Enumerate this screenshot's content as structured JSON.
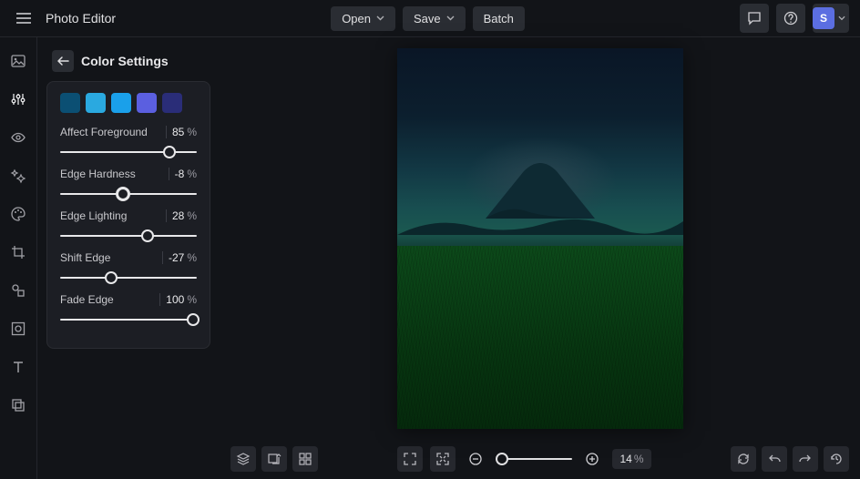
{
  "app_title": "Photo Editor",
  "top": {
    "open": "Open",
    "save": "Save",
    "batch": "Batch",
    "avatar_letter": "S"
  },
  "rail_icons": [
    "image-icon",
    "adjust-icon",
    "eye-icon",
    "effects-icon",
    "palette-icon",
    "crop-icon",
    "shapes-icon",
    "pattern-icon",
    "text-icon",
    "layers-copy-icon"
  ],
  "panel": {
    "title": "Color Settings",
    "swatches": [
      "#0b4f73",
      "#2aa9e0",
      "#1aa0ea",
      "#5b5fe0",
      "#2a2d78"
    ],
    "sliders": [
      {
        "label": "Affect Foreground",
        "value": 85,
        "pos_pct": 80,
        "big": false
      },
      {
        "label": "Edge Hardness",
        "value": -8,
        "pos_pct": 46,
        "big": true
      },
      {
        "label": "Edge Lighting",
        "value": 28,
        "pos_pct": 64,
        "big": false
      },
      {
        "label": "Shift Edge",
        "value": -27,
        "pos_pct": 37,
        "big": false
      },
      {
        "label": "Fade Edge",
        "value": 100,
        "pos_pct": 97,
        "big": false
      }
    ]
  },
  "zoom": {
    "value": 14,
    "thumb_pct": 8
  },
  "unit": "%"
}
